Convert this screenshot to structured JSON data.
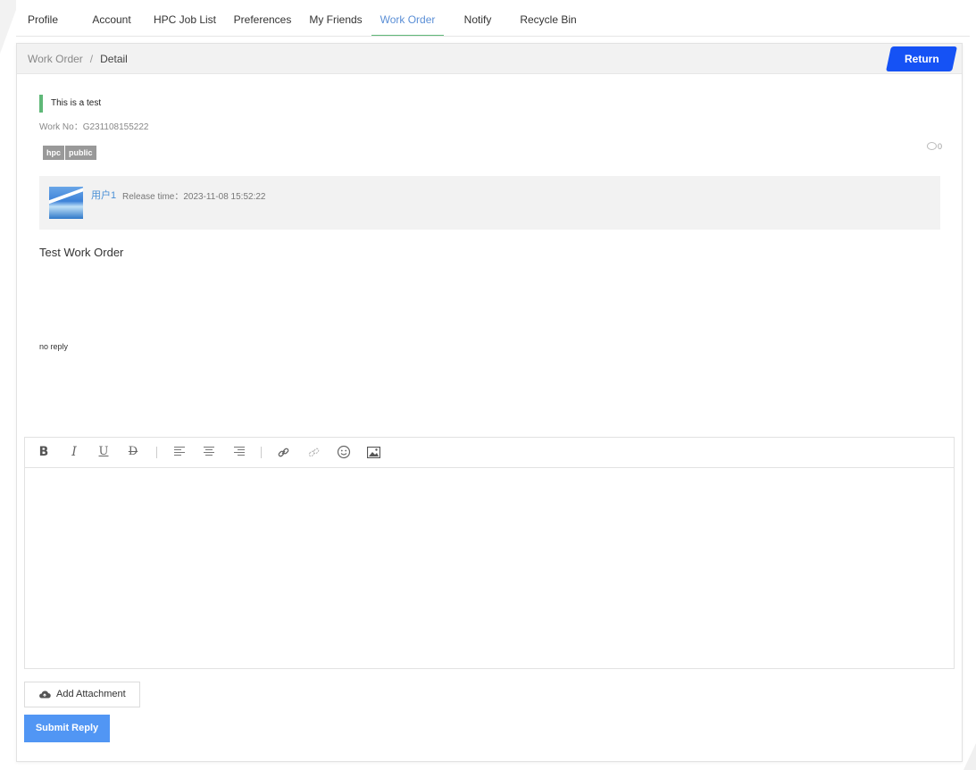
{
  "tabs": [
    {
      "label": "Profile",
      "active": false
    },
    {
      "label": "Account",
      "active": false
    },
    {
      "label": "HPC Job List",
      "active": false
    },
    {
      "label": "Preferences",
      "active": false
    },
    {
      "label": "My Friends",
      "active": false
    },
    {
      "label": "Work Order",
      "active": true
    },
    {
      "label": "Notify",
      "active": false
    },
    {
      "label": "Recycle Bin",
      "active": false
    }
  ],
  "breadcrumb": {
    "parent": "Work Order",
    "separator": "/",
    "current": "Detail"
  },
  "return_label": "Return",
  "work_order": {
    "title": "This is a test",
    "work_no": "Work No：G231108155222",
    "tags": [
      "hpc",
      "public"
    ],
    "comment_count": "0",
    "author": "用户1",
    "release_time": "Release time：2023-11-08 15:52:22",
    "body": "Test Work Order",
    "no_reply_text": "no reply"
  },
  "editor": {
    "tools": [
      "bold-icon",
      "italic-icon",
      "underline-icon",
      "strikethrough-icon",
      "align-left-icon",
      "align-center-icon",
      "align-right-icon",
      "link-icon",
      "unlink-icon",
      "emoji-icon",
      "image-icon"
    ],
    "content": ""
  },
  "actions": {
    "add_attachment": "Add Attachment",
    "submit_reply": "Submit Reply"
  },
  "colors": {
    "active_tab_text": "#5b8fd6",
    "active_tab_underline": "#5fb878",
    "return_button": "#1552f5",
    "submit_button": "#5196f4",
    "title_accent": "#5fb878",
    "author_link": "#4a90d6"
  }
}
